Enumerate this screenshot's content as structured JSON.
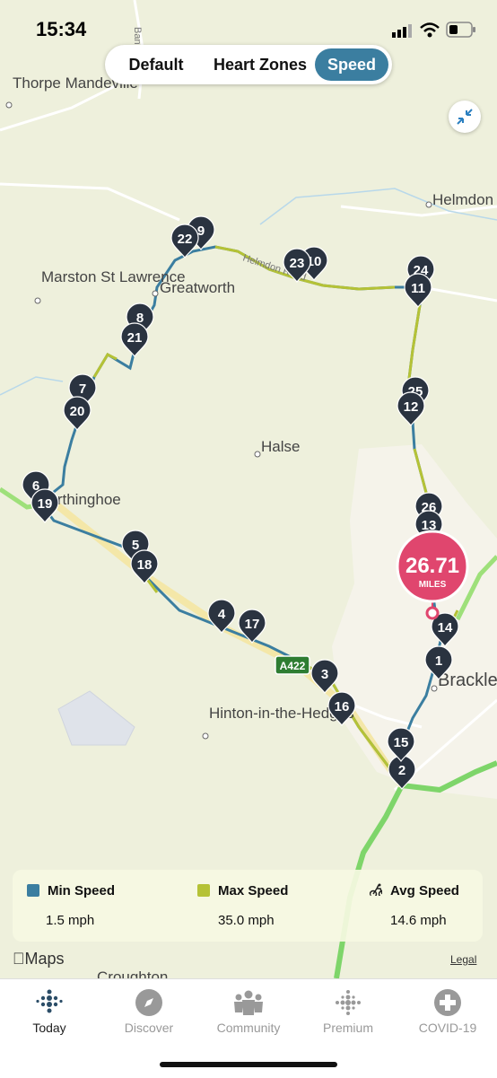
{
  "status_bar": {
    "time": "15:34"
  },
  "view_toggle": {
    "options": [
      "Default",
      "Heart Zones",
      "Speed"
    ],
    "selected": "Speed"
  },
  "map": {
    "places": [
      "Thorpe Mandeville",
      "Helmdon",
      "Marston St Lawrence",
      "Greatworth",
      "Halse",
      "Farthinghoe",
      "Hinton-in-the-Hedges",
      "Brackley",
      "Croughton"
    ],
    "road_labels": [
      "Helmdon Road",
      "A422",
      "Banbury"
    ],
    "markers": [
      "1",
      "2",
      "3",
      "4",
      "5",
      "6",
      "7",
      "8",
      "9",
      "10",
      "11",
      "12",
      "13",
      "14",
      "15",
      "16",
      "17",
      "18",
      "19",
      "20",
      "21",
      "22",
      "23",
      "24",
      "25",
      "26"
    ],
    "distance": {
      "value": "26.71",
      "unit": "MILES",
      "color": "#e0466e"
    }
  },
  "legend": {
    "min": {
      "label": "Min Speed",
      "value": "1.5 mph",
      "color": "#3b7ea0"
    },
    "max": {
      "label": "Max Speed",
      "value": "35.0 mph",
      "color": "#b5c236"
    },
    "avg": {
      "label": "Avg Speed",
      "value": "14.6 mph",
      "icon": "cyclist-icon"
    }
  },
  "maps_credit": "Maps",
  "legal": "Legal",
  "tabs": [
    {
      "label": "Today",
      "icon": "dots-grid-icon",
      "active": true
    },
    {
      "label": "Discover",
      "icon": "compass-icon",
      "active": false
    },
    {
      "label": "Community",
      "icon": "people-icon",
      "active": false
    },
    {
      "label": "Premium",
      "icon": "dots-star-icon",
      "active": false
    },
    {
      "label": "COVID-19",
      "icon": "plus-circle-icon",
      "active": false
    }
  ]
}
